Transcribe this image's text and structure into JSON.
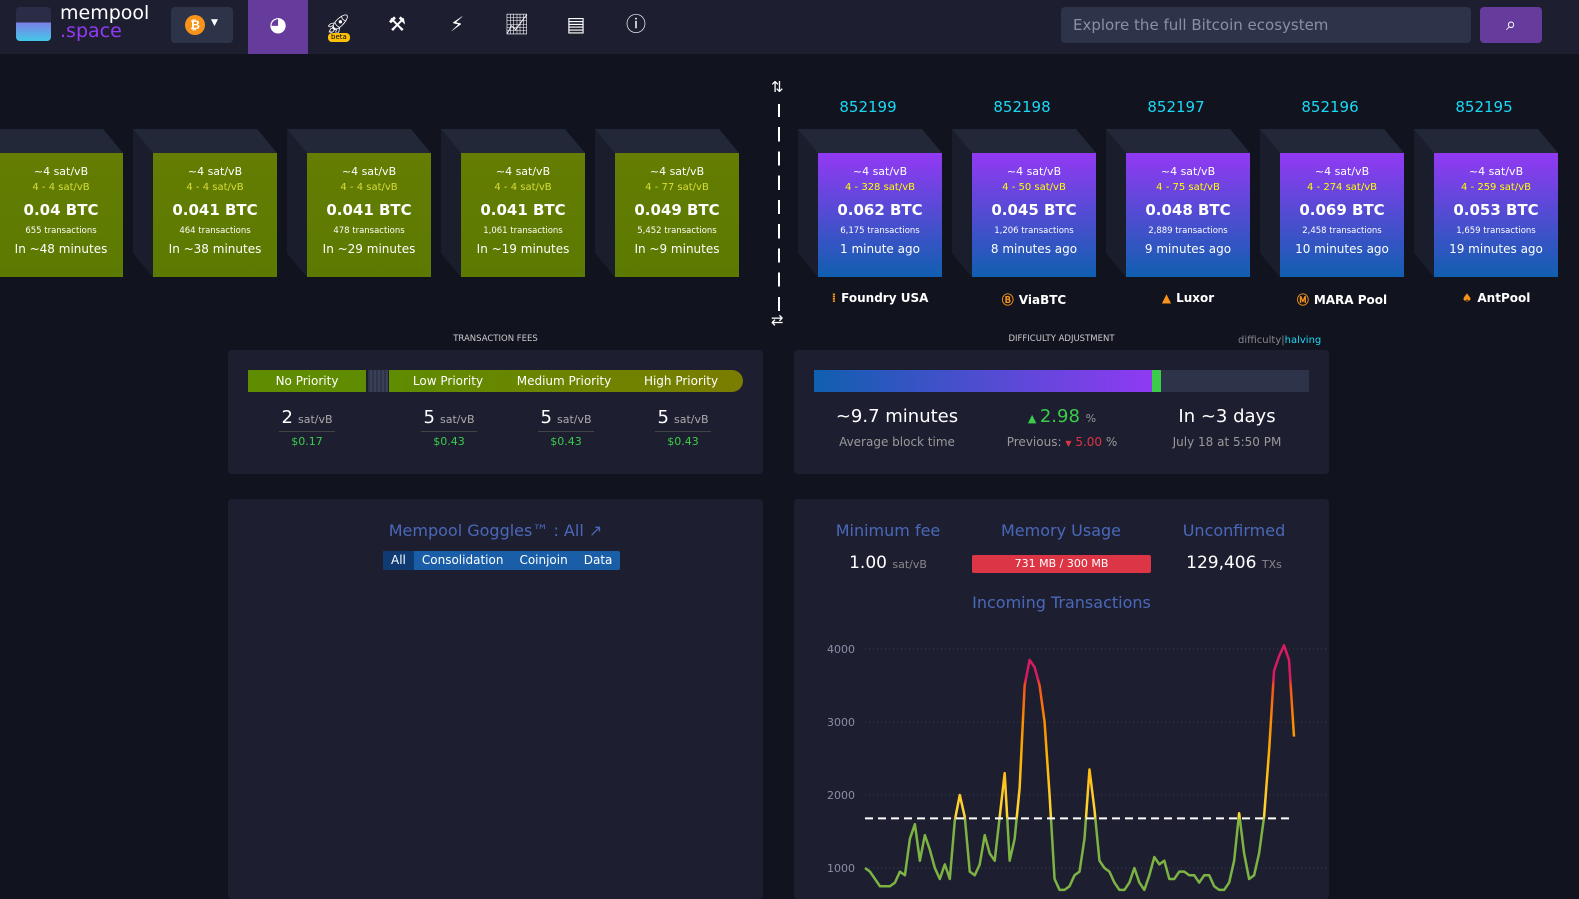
{
  "header": {
    "logo_top": "mempool",
    "logo_bottom": ".space",
    "network_icon": "bitcoin-icon",
    "nav": [
      {
        "icon": "dashboard-icon",
        "active": true
      },
      {
        "icon": "rocket-icon",
        "badge": "beta"
      },
      {
        "icon": "hammer-icon"
      },
      {
        "icon": "lightning-icon"
      },
      {
        "icon": "chart-area-icon"
      },
      {
        "icon": "book-icon"
      },
      {
        "icon": "info-icon"
      }
    ],
    "search_placeholder": "Explore the full Bitcoin ecosystem"
  },
  "mempool_blocks": [
    {
      "median": "~4 sat/vB",
      "range": "4 - 4 sat/vB",
      "total": "0.04 BTC",
      "txs": "655 transactions",
      "eta": "In ~48 minutes"
    },
    {
      "median": "~4 sat/vB",
      "range": "4 - 4 sat/vB",
      "total": "0.041 BTC",
      "txs": "464 transactions",
      "eta": "In ~38 minutes"
    },
    {
      "median": "~4 sat/vB",
      "range": "4 - 4 sat/vB",
      "total": "0.041 BTC",
      "txs": "478 transactions",
      "eta": "In ~29 minutes"
    },
    {
      "median": "~4 sat/vB",
      "range": "4 - 4 sat/vB",
      "total": "0.041 BTC",
      "txs": "1,061 transactions",
      "eta": "In ~19 minutes"
    },
    {
      "median": "~4 sat/vB",
      "range": "4 - 77 sat/vB",
      "total": "0.049 BTC",
      "txs": "5,452 transactions",
      "eta": "In ~9 minutes"
    }
  ],
  "mined_blocks": [
    {
      "height": "852199",
      "median": "~4 sat/vB",
      "range": "4 - 328 sat/vB",
      "total": "0.062 BTC",
      "txs": "6,175 transactions",
      "age": "1 minute ago",
      "pool": "Foundry USA",
      "pool_icon": "⁞"
    },
    {
      "height": "852198",
      "median": "~4 sat/vB",
      "range": "4 - 50 sat/vB",
      "total": "0.045 BTC",
      "txs": "1,206 transactions",
      "age": "8 minutes ago",
      "pool": "ViaBTC",
      "pool_icon": "Ⓑ"
    },
    {
      "height": "852197",
      "median": "~4 sat/vB",
      "range": "4 - 75 sat/vB",
      "total": "0.048 BTC",
      "txs": "2,889 transactions",
      "age": "9 minutes ago",
      "pool": "Luxor",
      "pool_icon": "▲"
    },
    {
      "height": "852196",
      "median": "~4 sat/vB",
      "range": "4 - 274 sat/vB",
      "total": "0.069 BTC",
      "txs": "2,458 transactions",
      "age": "10 minutes ago",
      "pool": "MARA Pool",
      "pool_icon": "Ⓜ"
    },
    {
      "height": "852195",
      "median": "~4 sat/vB",
      "range": "4 - 259 sat/vB",
      "total": "0.053 BTC",
      "txs": "1,659 transactions",
      "age": "19 minutes ago",
      "pool": "AntPool",
      "pool_icon": "♠"
    }
  ],
  "fees": {
    "title": "TRANSACTION FEES",
    "labels": [
      "No Priority",
      "Low Priority",
      "Medium Priority",
      "High Priority"
    ],
    "values": [
      {
        "n": "2",
        "unit": "sat/vB",
        "usd": "$0.17"
      },
      {
        "n": "5",
        "unit": "sat/vB",
        "usd": "$0.43"
      },
      {
        "n": "5",
        "unit": "sat/vB",
        "usd": "$0.43"
      },
      {
        "n": "5",
        "unit": "sat/vB",
        "usd": "$0.43"
      }
    ]
  },
  "difficulty": {
    "title": "DIFFICULTY ADJUSTMENT",
    "toggle_a": "difficulty",
    "toggle_sep": "|",
    "toggle_b": "halving",
    "progress_pct": 70,
    "avg_time": "~9.7 minutes",
    "avg_label": "Average block time",
    "change": "2.98",
    "pct": "%",
    "previous_label": "Previous:",
    "previous": "5.00",
    "eta": "In ~3 days",
    "eta_date": "July 18 at 5:50 PM",
    "colors": {
      "up": "#3bcc49",
      "down": "#dc3545"
    }
  },
  "goggles": {
    "title": "Mempool Goggles™ : All",
    "tabs": [
      "All",
      "Consolidation",
      "Coinjoin",
      "Data"
    ]
  },
  "stats": {
    "min_fee_label": "Minimum fee",
    "min_fee": "1.00",
    "min_fee_unit": "sat/vB",
    "mem_label": "Memory Usage",
    "mem": "731 MB / 300 MB",
    "unconf_label": "Unconfirmed",
    "unconf": "129,406",
    "unconf_unit": "TXs",
    "incoming_label": "Incoming Transactions"
  },
  "chart_data": {
    "type": "line",
    "title": "Incoming Transactions",
    "yticks": [
      "1000",
      "2000",
      "3000",
      "4000"
    ],
    "ylim": [
      0,
      4200
    ],
    "threshold": 1680,
    "values": [
      1000,
      950,
      850,
      750,
      750,
      750,
      800,
      950,
      900,
      1400,
      1600,
      1100,
      1450,
      1250,
      1000,
      850,
      1050,
      850,
      1650,
      2000,
      1700,
      950,
      900,
      1050,
      1450,
      1200,
      1100,
      1700,
      2300,
      1100,
      1400,
      2100,
      3500,
      3850,
      3750,
      3500,
      3000,
      2000,
      850,
      700,
      700,
      750,
      900,
      950,
      1400,
      2350,
      1800,
      1100,
      1000,
      950,
      800,
      700,
      700,
      800,
      1000,
      800,
      700,
      900,
      1150,
      1050,
      1100,
      850,
      850,
      950,
      950,
      900,
      900,
      800,
      900,
      900,
      750,
      700,
      700,
      800,
      1100,
      1750,
      1200,
      850,
      900,
      1200,
      1700,
      2600,
      3700,
      3900,
      4050,
      3850,
      2800
    ]
  }
}
